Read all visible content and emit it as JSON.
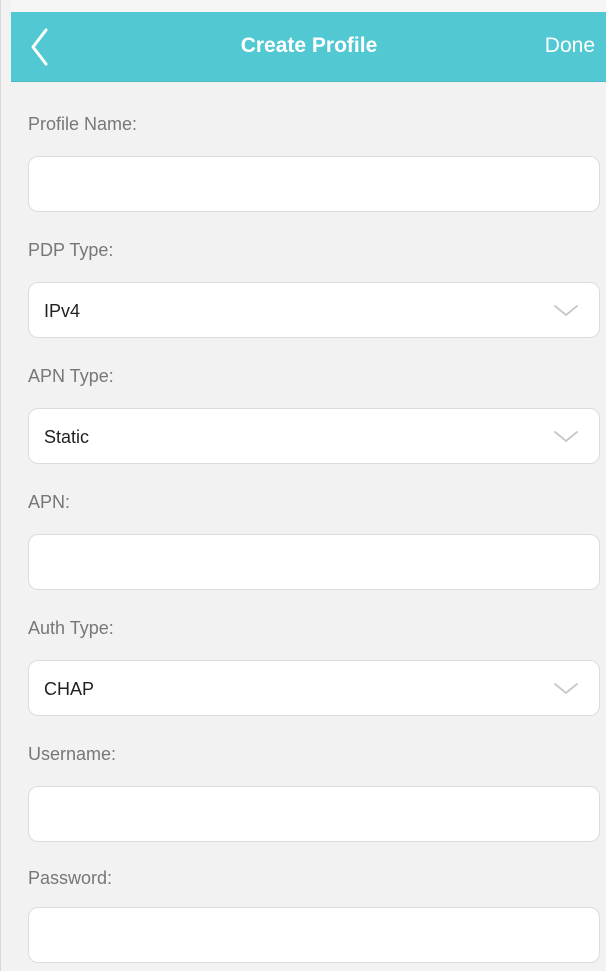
{
  "header": {
    "title": "Create Profile",
    "done_label": "Done",
    "back_icon": "chevron-left-icon"
  },
  "form": {
    "profile_name": {
      "label": "Profile Name:",
      "value": ""
    },
    "pdp_type": {
      "label": "PDP Type:",
      "value": "IPv4",
      "icon": "chevron-down-icon"
    },
    "apn_type": {
      "label": "APN Type:",
      "value": "Static",
      "icon": "chevron-down-icon"
    },
    "apn": {
      "label": "APN:",
      "value": ""
    },
    "auth_type": {
      "label": "Auth Type:",
      "value": "CHAP",
      "icon": "chevron-down-icon"
    },
    "username": {
      "label": "Username:",
      "value": ""
    },
    "password": {
      "label": "Password:",
      "value": ""
    }
  },
  "colors": {
    "accent": "#52c8d3",
    "background": "#f2f2f2",
    "field_background": "#ffffff",
    "label_text": "#777777",
    "value_text": "#222222"
  }
}
